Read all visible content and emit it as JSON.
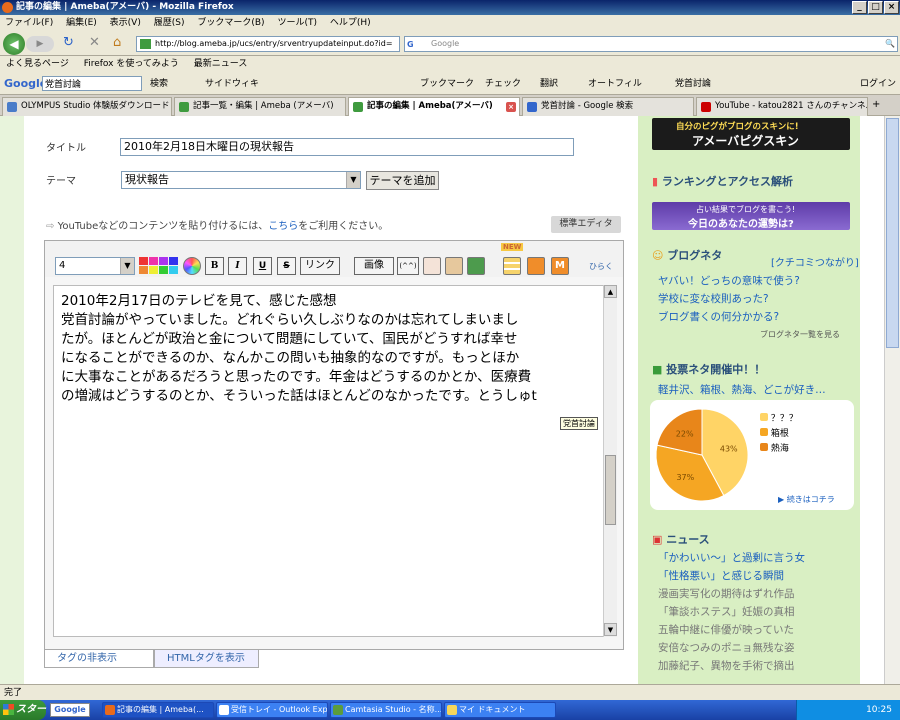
{
  "window": {
    "title": "記事の編集 | Ameba(アメーバ) - Mozilla Firefox",
    "btn_min": "_",
    "btn_max": "□",
    "btn_close": "×"
  },
  "menu": [
    "ファイル(F)",
    "編集(E)",
    "表示(V)",
    "履歴(S)",
    "ブックマーク(B)",
    "ツール(T)",
    "ヘルプ(H)"
  ],
  "nav": {
    "back": "◀",
    "forward": "▶",
    "reload": "↻",
    "stop": "✕",
    "home": "⌂",
    "url": "http://blog.ameba.jp/ucs/entry/srventryupdateinput.do?id=",
    "search_placeholder": "Google",
    "search_engine": "G",
    "search_icon": "🔍"
  },
  "bookmarks": [
    "よく見るページ",
    "Firefox を使ってみよう",
    "最新ニュース"
  ],
  "google_toolbar": {
    "logo": "Google",
    "query": "党首討論",
    "items": [
      "検索",
      "サイドウィキ",
      "ブックマーク",
      "チェック",
      "翻訳",
      "オートフィル",
      "党首討論",
      "ログイン"
    ]
  },
  "tabs": [
    {
      "label": "OLYMPUS Studio 体験版ダウンロード",
      "active": false
    },
    {
      "label": "記事一覧・編集 | Ameba (アメーバ)",
      "active": false
    },
    {
      "label": "記事の編集 | Ameba(アメーバ)",
      "active": true
    },
    {
      "label": "党首討論 - Google 検索",
      "active": false
    },
    {
      "label": "YouTube - katou2821 さんのチャンネル",
      "active": false
    }
  ],
  "form": {
    "title_label": "タイトル",
    "title_value": "2010年2月18日木曜日の現状報告",
    "theme_label": "テーマ",
    "theme_value": "現状報告",
    "add_theme": "テーマを追加",
    "hint_prefix": "YouTubeなどのコンテンツを貼り付けるには、",
    "hint_link": "こちら",
    "hint_suffix": "をご利用ください。",
    "standard_editor": "標準エディタ"
  },
  "editor": {
    "font_size": "4",
    "bold": "B",
    "italic": "I",
    "underline": "U",
    "strike": "S",
    "link": "リンク",
    "image": "画像",
    "emoji": "(^^)",
    "new_badge": "NEW",
    "expand": "ひらく",
    "lines": [
      "2010年2月17日のテレビを見て、感じた感想",
      "党首討論がやっていました。どれぐらい久しぶりなのかは忘れてしまいまし",
      "たが。ほとんどが政治と金について問題にしていて、国民がどうすれば幸せ",
      "になることができるのか、なんかこの問いも抽象的なのですが。もっとほか",
      "に大事なことがあるだろうと思ったのです。年金はどうするのかとか、医療費",
      "の増減はどうするのとか、そういった話はほとんどのなかったです。とうしゅt"
    ],
    "ime_tooltip": "党首討論",
    "tab_hide_tags": "タグの非表示",
    "tab_html": "HTMLタグを表示"
  },
  "sidebar": {
    "banner1_text": "自分のピグがブログのスキンに!",
    "banner1_sub": "アメーバピグスキン",
    "ranking_title": "ランキングとアクセス解析",
    "banner2_text": "占い結果でブログを書こう!",
    "banner2_sub": "今日のあなたの運勢は?",
    "neta_title": "ブログネタ",
    "neta_side": "[クチコミつながり]",
    "neta_links": [
      "ヤバい！どっちの意味で使う?",
      "学校に変な校則あった?",
      "ブログ書くの何分かかる?"
    ],
    "neta_list": "ブログネタ一覧を見る",
    "vote_title": "投票ネタ開催中！！",
    "vote_sub": "軽井沢、箱根、熱海、どこが好き…",
    "vote_more": "続きはコチラ",
    "news_title": "ニュース",
    "news": [
      "「かわいい〜」と過剰に言う女",
      "「性格悪い」と感じる瞬間",
      "漫画実写化の期待はずれ作品",
      "「筆談ホステス」妊娠の真相",
      "五輪中継に俳優が映っていた",
      "安倍なつみのポニョ無残な姿",
      "加藤紀子、異物を手術で摘出"
    ]
  },
  "chart_data": {
    "type": "pie",
    "categories": [
      "？？？",
      "箱根",
      "熱海"
    ],
    "values": [
      43,
      37,
      22
    ],
    "labels": [
      "43%",
      "37%",
      "22%"
    ],
    "colors": [
      "#ffd466",
      "#f5a623",
      "#e8861a"
    ]
  },
  "status": {
    "text": "完了"
  },
  "taskbar": {
    "start": "スタート",
    "google": "Google",
    "tasks": [
      {
        "label": "記事の編集 | Ameba(...",
        "active": true
      },
      {
        "label": "受信トレイ - Outlook Exp...",
        "active": false
      },
      {
        "label": "Camtasia Studio - 名称...",
        "active": false
      },
      {
        "label": "マイ ドキュメント",
        "active": false
      }
    ],
    "clock": "10:25"
  }
}
